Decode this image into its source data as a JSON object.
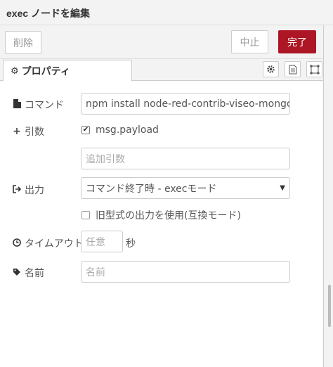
{
  "header": {
    "title": "exec ノードを編集"
  },
  "toolbar": {
    "delete_label": "削除",
    "cancel_label": "中止",
    "done_label": "完了",
    "done_color": "#ad1625"
  },
  "tabs": {
    "properties_label": "プロパティ",
    "icons": [
      "gear-icon",
      "description-icon",
      "appearance-icon"
    ]
  },
  "form": {
    "command": {
      "label": "コマンド",
      "value": "npm install node-red-contrib-viseo-mongodb -g"
    },
    "args": {
      "label": "引数",
      "checkbox_label": "msg.payload",
      "checkbox_checked": true,
      "extra_placeholder": "追加引数"
    },
    "output": {
      "label": "出力",
      "selected": "コマンド終了時 - execモード",
      "legacy_label": "旧型式の出力を使用(互換モード)",
      "legacy_checked": false
    },
    "timeout": {
      "label": "タイムアウト",
      "placeholder": "任意",
      "unit": "秒"
    },
    "name": {
      "label": "名前",
      "placeholder": "名前"
    }
  }
}
